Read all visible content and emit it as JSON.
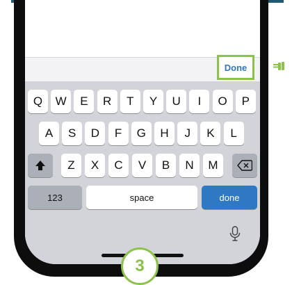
{
  "accessory_bar": {
    "done_label": "Done"
  },
  "keyboard": {
    "row1": [
      "Q",
      "W",
      "E",
      "R",
      "T",
      "Y",
      "U",
      "I",
      "O",
      "P"
    ],
    "row2": [
      "A",
      "S",
      "D",
      "F",
      "G",
      "H",
      "J",
      "K",
      "L"
    ],
    "row3": [
      "Z",
      "X",
      "C",
      "V",
      "B",
      "N",
      "M"
    ],
    "numbers_label": "123",
    "space_label": "space",
    "done_label": "done",
    "shift_icon": "shift-up-arrow-icon",
    "delete_icon": "backspace-icon",
    "mic_icon": "microphone-icon"
  },
  "step_badge": {
    "number": "3"
  },
  "pointer_icon": "pointing-hand-icon",
  "colors": {
    "accent_green": "#8bc34a",
    "key_blue": "#2f78c4",
    "keyboard_bg": "#d2d4d9",
    "top_line": "#1f5c73"
  }
}
